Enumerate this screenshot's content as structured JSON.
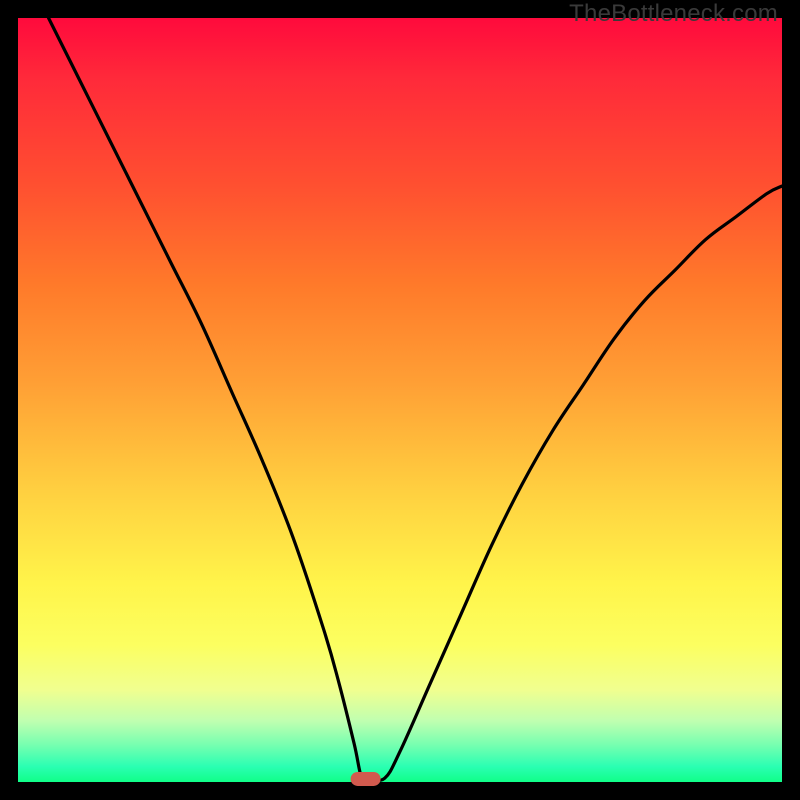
{
  "watermark": "TheBottleneck.com",
  "chart_data": {
    "type": "line",
    "title": "",
    "xlabel": "",
    "ylabel": "",
    "xlim": [
      0,
      100
    ],
    "ylim": [
      0,
      100
    ],
    "x": [
      4,
      8,
      12,
      16,
      20,
      24,
      28,
      32,
      36,
      40,
      42,
      44,
      45,
      46,
      48,
      50,
      54,
      58,
      62,
      66,
      70,
      74,
      78,
      82,
      86,
      90,
      94,
      98,
      100
    ],
    "values": [
      100,
      92,
      84,
      76,
      68,
      60,
      51,
      42,
      32,
      20,
      13,
      5,
      0.5,
      0.5,
      0.5,
      4,
      13,
      22,
      31,
      39,
      46,
      52,
      58,
      63,
      67,
      71,
      74,
      77,
      78
    ],
    "marker": {
      "x": 45.5,
      "y": 0.4,
      "shape": "pill"
    },
    "grid": false,
    "legend": false
  }
}
